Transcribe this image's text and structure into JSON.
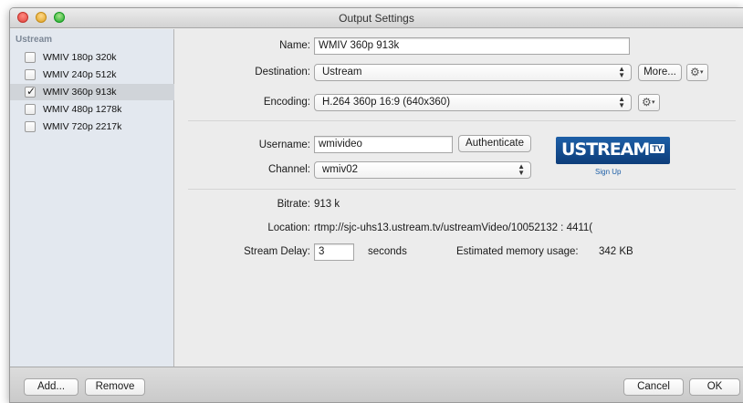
{
  "window": {
    "title": "Output Settings"
  },
  "sidebar": {
    "header": "Ustream",
    "presets": [
      {
        "label": "WMIV 180p 320k",
        "checked": false
      },
      {
        "label": "WMIV 240p 512k",
        "checked": false
      },
      {
        "label": "WMIV 360p 913k",
        "checked": true
      },
      {
        "label": "WMIV 480p 1278k",
        "checked": false
      },
      {
        "label": "WMIV 720p 2217k",
        "checked": false
      }
    ],
    "check_mark": "✓"
  },
  "form": {
    "name_label": "Name:",
    "name_value": "WMIV 360p 913k",
    "destination_label": "Destination:",
    "destination_value": "Ustream",
    "more_button": "More...",
    "encoding_label": "Encoding:",
    "encoding_value": "H.264 360p 16:9 (640x360)",
    "username_label": "Username:",
    "username_value": "wmivideo",
    "authenticate_button": "Authenticate",
    "channel_label": "Channel:",
    "channel_value": "wmiv02",
    "bitrate_label": "Bitrate:",
    "bitrate_value": "913 k",
    "location_label": "Location:",
    "location_value": "rtmp://sjc-uhs13.ustream.tv/ustreamVideo/10052132 : 4411(",
    "stream_delay_label": "Stream Delay:",
    "stream_delay_value": "3",
    "seconds_label": "seconds",
    "memory_label": "Estimated memory usage:",
    "memory_value": "342 KB"
  },
  "logo": {
    "text": "USTREAM",
    "tv": "TV",
    "signup": "Sign Up"
  },
  "bottom": {
    "add_button": "Add...",
    "remove_button": "Remove",
    "cancel_button": "Cancel",
    "ok_button": "OK"
  },
  "icons": {
    "gear": "⚙",
    "caret": "▾",
    "up": "▲",
    "down": "▼"
  }
}
